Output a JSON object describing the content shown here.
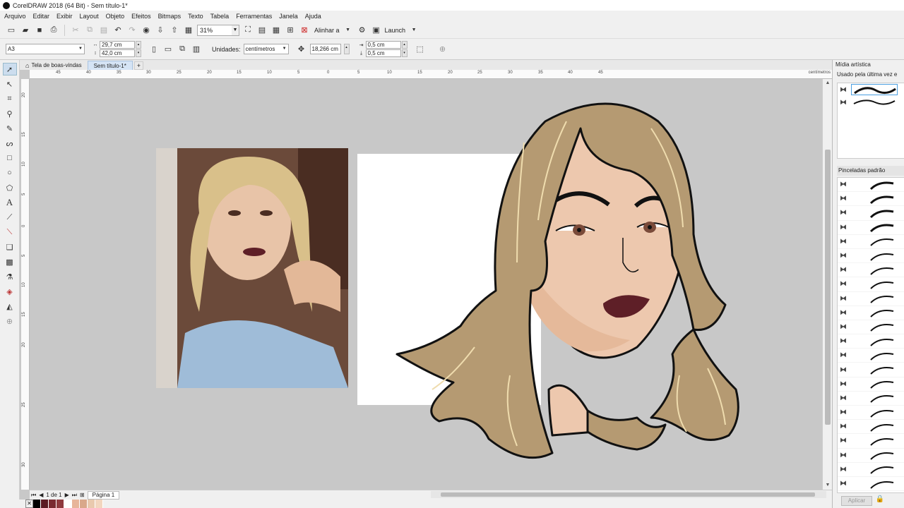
{
  "window": {
    "title": "CorelDRAW 2018 (64 Bit) - Sem título-1*"
  },
  "menu": [
    "Arquivo",
    "Editar",
    "Exibir",
    "Layout",
    "Objeto",
    "Efeitos",
    "Bitmaps",
    "Texto",
    "Tabela",
    "Ferramentas",
    "Janela",
    "Ajuda"
  ],
  "toolbar": {
    "zoom": "31%",
    "align_label": "Alinhar a",
    "launch_label": "Launch"
  },
  "properties": {
    "page_size": "A3",
    "width": "29,7 cm",
    "height": "42,0 cm",
    "units_label": "Unidades:",
    "units_value": "centímetros",
    "nudge": "18,266 cm",
    "dup_x": "0,5 cm",
    "dup_y": "0,5 cm"
  },
  "tabs": [
    {
      "label": "Tela de boas-vindas"
    },
    {
      "label": "Sem título-1*"
    }
  ],
  "ruler": {
    "h_ticks": [
      "45",
      "40",
      "35",
      "30",
      "25",
      "20",
      "15",
      "10",
      "5",
      "0",
      "5",
      "10",
      "15",
      "20",
      "25",
      "30",
      "35",
      "40",
      "45"
    ],
    "units": "centímetros",
    "v_ticks": [
      "20",
      "15",
      "10",
      "5",
      "0",
      "5",
      "10",
      "15",
      "20",
      "25",
      "30"
    ]
  },
  "status": {
    "page_count": "1 de 1",
    "page_tab": "Página 1"
  },
  "docker": {
    "title": "Mídia artística",
    "recent_label": "Usado pela última vez e",
    "section2": "Pinceladas padrão",
    "apply": "Aplicar"
  },
  "palette": [
    "#000000",
    "#5b1a22",
    "#7a2a30",
    "#8f3a3e",
    "#ffffff",
    "#e7b59a",
    "#d9a88a",
    "#e9c9ae",
    "#f2d6bf"
  ],
  "colors": {
    "hair": "#b59a72",
    "hair_highlight": "#efdcae",
    "skin": "#edc8ae",
    "skin_shadow": "#e5b99a",
    "lips": "#5e1f27",
    "iris": "#7a4b3a"
  }
}
